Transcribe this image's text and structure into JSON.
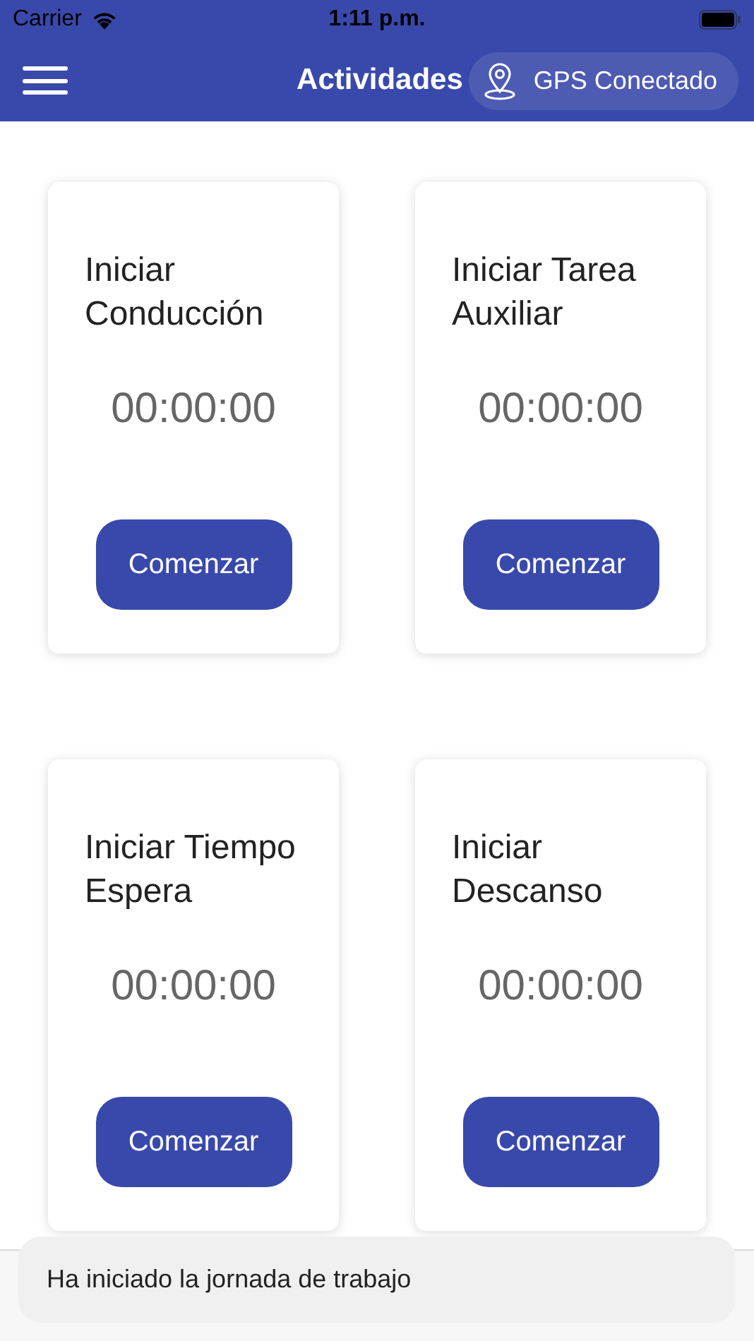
{
  "status_bar": {
    "carrier": "Carrier",
    "time": "1:11 p.m."
  },
  "header": {
    "title": "Actividades",
    "gps": {
      "label": "GPS Conectado"
    }
  },
  "activities": [
    {
      "title": "Iniciar Conducción",
      "timer": "00:00:00",
      "button": "Comenzar"
    },
    {
      "title": "Iniciar Tarea Auxiliar",
      "timer": "00:00:00",
      "button": "Comenzar"
    },
    {
      "title": "Iniciar Tiempo Espera",
      "timer": "00:00:00",
      "button": "Comenzar"
    },
    {
      "title": "Iniciar Descanso",
      "timer": "00:00:00",
      "button": "Comenzar"
    }
  ],
  "toast": {
    "message": "Ha iniciado la jornada de trabajo"
  }
}
